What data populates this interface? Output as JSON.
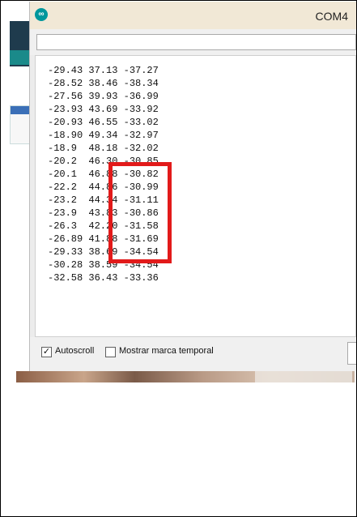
{
  "window": {
    "title": "COM4",
    "logo_icon": "arduino-icon",
    "accent_color": "#00979c"
  },
  "send_input": {
    "value": ""
  },
  "output": {
    "lines": [
      "-29.43 37.13 -37.27",
      "-28.52 38.46 -38.34",
      "-27.56 39.93 -36.99",
      "-23.93 43.69 -33.92",
      "-20.93 46.55 -33.02",
      "-18.90 49.34 -32.97",
      "-18.9  48.18 -32.02",
      "-20.2  46.30 -30.85",
      "-20.1  46.88 -30.82",
      "-22.2  44.86 -30.99",
      "-23.2  44.34 -31.11",
      "-23.9  43.83 -30.86",
      "-26.3  42.20 -31.58",
      "-26.89 41.88 -31.69",
      "-29.33 38.69 -34.54",
      "-30.28 38.59 -34.54",
      "-32.58 36.43 -33.36"
    ],
    "highlight_color": "#e21a1a"
  },
  "footer": {
    "autoscroll_label": "Autoscroll",
    "autoscroll_checked": true,
    "timestamp_label": "Mostrar marca temporal",
    "timestamp_checked": false
  }
}
